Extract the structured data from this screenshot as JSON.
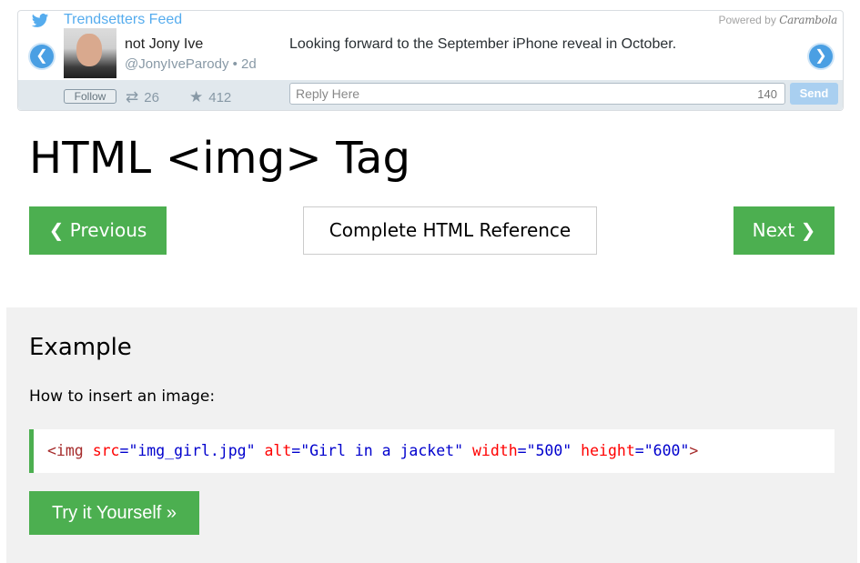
{
  "widget": {
    "feed_title": "Trendsetters Feed",
    "powered_by": "Powered by",
    "brand": "Carambola",
    "icons": {
      "bird": "twitter-bird-icon",
      "prev": "chevron-left-icon",
      "next": "chevron-right-icon",
      "retweet": "retweet-icon",
      "favorite": "star-icon"
    },
    "tweet": {
      "name": "not Jony Ive",
      "handle": "@JonyIveParody • 2d",
      "text": "Looking forward to the September iPhone reveal in October."
    },
    "follow_label": "Follow",
    "retweets": "26",
    "favorites": "412",
    "reply_placeholder": "Reply Here",
    "char_count": "140",
    "send_label": "Send",
    "accent": "#55acee"
  },
  "page": {
    "title": "HTML <img> Tag",
    "prev_label": "❮ Previous",
    "reference_label": "Complete HTML Reference",
    "next_label": "Next ❯",
    "accent": "#4caf50"
  },
  "example": {
    "heading": "Example",
    "description": "How to insert an image:",
    "code": {
      "open": "<img",
      "attr_src": "src",
      "val_src": "\"img_girl.jpg\"",
      "attr_alt": "alt",
      "val_alt": "\"Girl in a jacket\"",
      "attr_width": "width",
      "val_width": "\"500\"",
      "attr_height": "height",
      "val_height": "\"600\"",
      "close": ">"
    },
    "try_label": "Try it Yourself »"
  }
}
